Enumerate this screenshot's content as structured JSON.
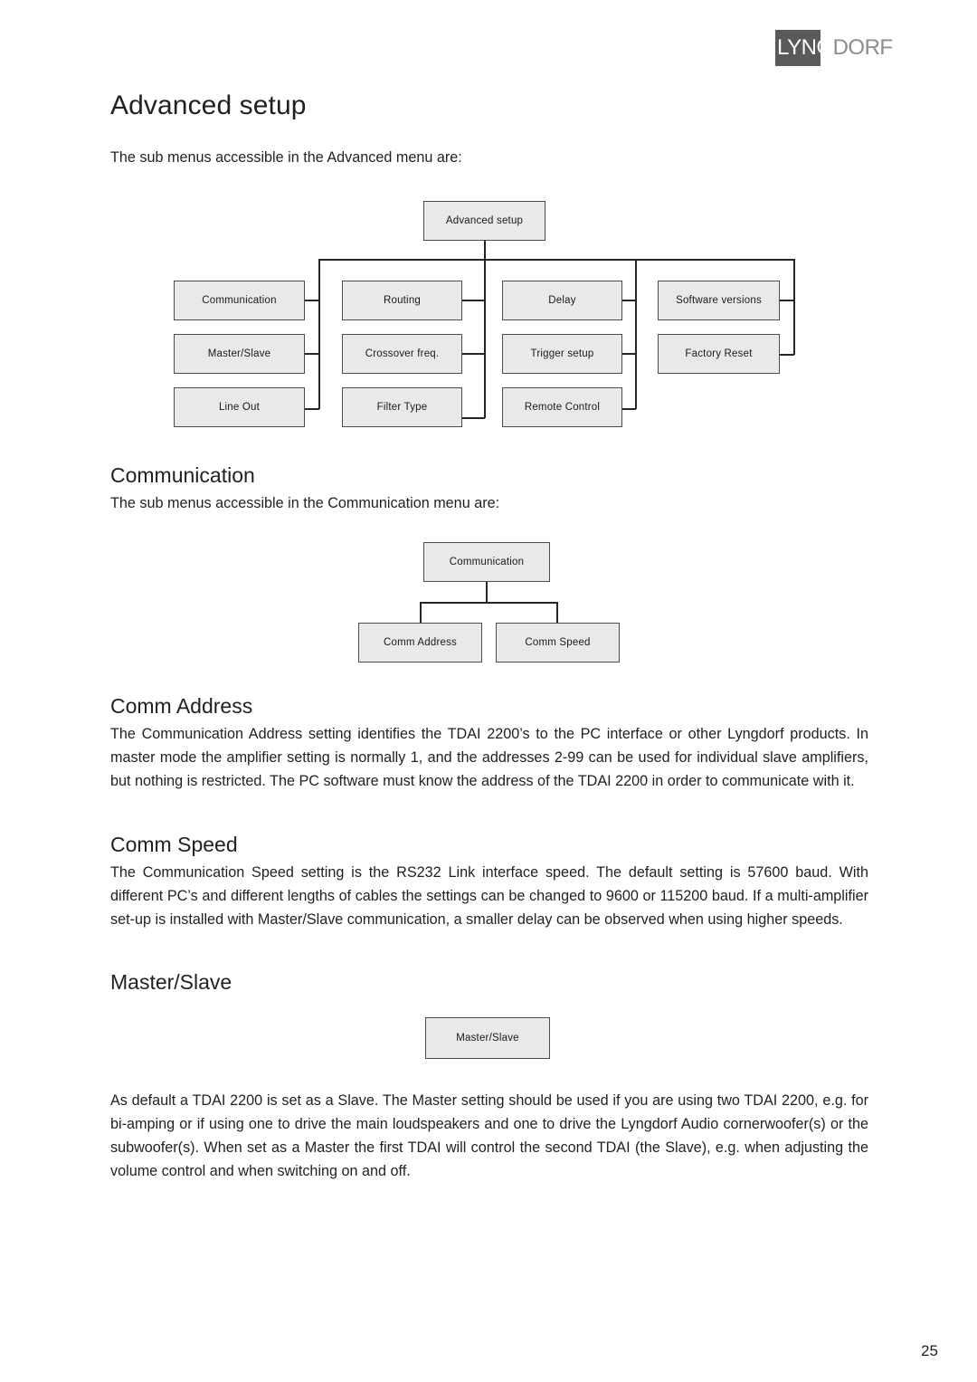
{
  "brand": {
    "logo_part1": "LYNG",
    "logo_part2": "DORF"
  },
  "page": {
    "number": "25",
    "title": "Advanced setup",
    "intro": "The sub menus accessible in the Advanced menu are:"
  },
  "sections": {
    "communication": {
      "heading": "Communication",
      "intro": "The sub menus accessible in the Communication menu are:"
    },
    "comm_address": {
      "heading": "Comm Address",
      "body": "The Communication Address setting identifies the TDAI 2200’s to the PC interface or other Lyngdorf products. In master mode the amplifier setting is normally 1, and the addresses 2-99 can be used for individual slave amplifiers, but nothing is restricted. The PC software must know the address of the TDAI 2200 in order to communicate with it."
    },
    "comm_speed": {
      "heading": "Comm Speed",
      "body": "The Communication Speed setting is the RS232 Link interface speed. The default setting is 57600 baud. With different PC’s and different lengths of cables the settings can be changed to 9600 or 115200 baud. If a multi-amplifier set-up is installed with Master/Slave communication, a smaller delay can be observed when using higher speeds."
    },
    "master_slave": {
      "heading": "Master/Slave",
      "body": "As default a TDAI 2200 is set as a Slave. The Master setting should be used if you are using two TDAI 2200, e.g. for bi-amping or if using one to drive the main loudspeakers and one to drive the Lyngdorf Audio cornerwoofer(s) or the subwoofer(s). When set as a Master the first TDAI will control the second TDAI (the Slave), e.g. when adjusting the volume control and when switching on and off."
    }
  },
  "diagram_advanced": {
    "root": "Advanced setup",
    "columns": [
      {
        "items": [
          "Communication",
          "Master/Slave",
          "Line Out"
        ]
      },
      {
        "items": [
          "Routing",
          "Crossover freq.",
          "Filter Type"
        ]
      },
      {
        "items": [
          "Delay",
          "Trigger setup",
          "Remote Control"
        ]
      },
      {
        "items": [
          "Software versions",
          "Factory Reset"
        ]
      }
    ]
  },
  "diagram_communication": {
    "root": "Communication",
    "children": [
      "Comm Address",
      "Comm Speed"
    ]
  },
  "diagram_master_slave": {
    "root": "Master/Slave"
  },
  "colors": {
    "node_fill": "#e9e9e9",
    "node_border": "#4d4d4d",
    "logo_box": "#5a5a5a",
    "logo_dorf": "#8c8c8c",
    "text": "#231f20"
  }
}
